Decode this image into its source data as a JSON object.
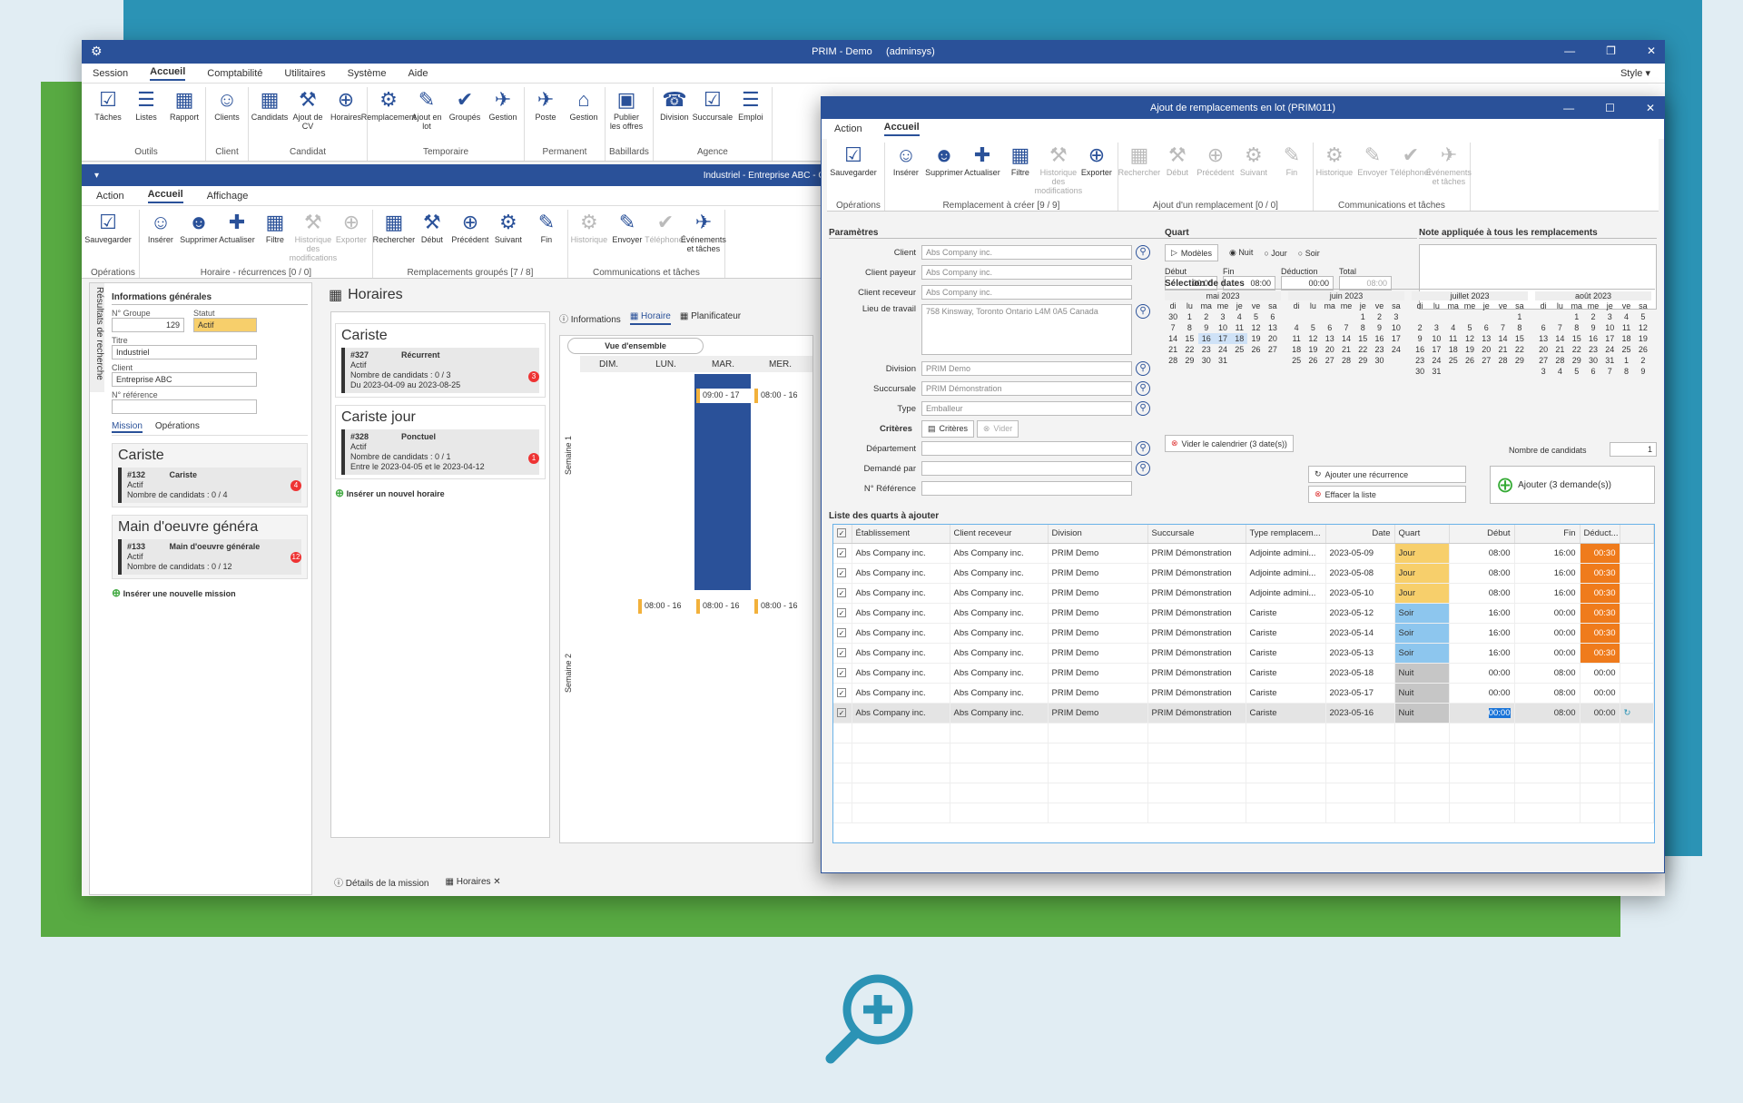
{
  "app": {
    "title": "PRIM - Demo",
    "user": "(adminsys)",
    "style_label": "Style"
  },
  "menu": [
    "Session",
    "Accueil",
    "Comptabilité",
    "Utilitaires",
    "Système",
    "Aide"
  ],
  "ribbon": {
    "groups": [
      {
        "label": "Outils",
        "buttons": [
          "Tâches",
          "Listes",
          "Rapport"
        ]
      },
      {
        "label": "Client",
        "buttons": [
          "Clients"
        ]
      },
      {
        "label": "Candidat",
        "buttons": [
          "Candidats",
          "Ajout de CV",
          "Horaires"
        ]
      },
      {
        "label": "Temporaire",
        "buttons": [
          "Remplacement",
          "Ajout en lot",
          "Groupés",
          "Gestion"
        ]
      },
      {
        "label": "Permanent",
        "buttons": [
          "Poste",
          "Gestion"
        ]
      },
      {
        "label": "Babillards",
        "buttons": [
          "Publier les offres"
        ]
      },
      {
        "label": "Agence",
        "buttons": [
          "Division",
          "Succursale",
          "Emploi"
        ]
      }
    ]
  },
  "sub": {
    "title": "Industriel - Entreprise ABC - Gestion des requêtes de temporaire multiple (PRIM005)",
    "tabs": [
      "Action",
      "Accueil",
      "Affichage"
    ],
    "groups": [
      {
        "label": "Opérations",
        "buttons": [
          "Sauvegarder"
        ]
      },
      {
        "label": "Horaire - récurrences [0 / 0]",
        "buttons": [
          "Insérer",
          "Supprimer",
          "Actualiser",
          "Filtre",
          "Historique des modifications",
          "Exporter"
        ]
      },
      {
        "label": "Remplacements groupés [7 / 8]",
        "buttons": [
          "Rechercher",
          "Début",
          "Précédent",
          "Suivant",
          "Fin"
        ]
      },
      {
        "label": "Communications et tâches",
        "buttons": [
          "Historique",
          "Envoyer",
          "Téléphoner",
          "Événements et tâches"
        ]
      }
    ]
  },
  "left": {
    "vtab": "Résultats de recherche",
    "section": "Informations générales",
    "groupe_label": "N° Groupe",
    "groupe": "129",
    "statut_label": "Statut",
    "statut": "Actif",
    "titre_label": "Titre",
    "titre": "Industriel",
    "client_label": "Client",
    "client": "Entreprise ABC",
    "ref_label": "N° référence",
    "tabs": [
      "Mission",
      "Opérations"
    ],
    "cards": [
      {
        "title": "Cariste",
        "id": "#132",
        "name": "Cariste",
        "status": "Actif",
        "cand": "Nombre de candidats : 0 / 4",
        "badge": "4"
      },
      {
        "title": "Main d'oeuvre généra",
        "id": "#133",
        "name": "Main d'oeuvre générale",
        "status": "Actif",
        "cand": "Nombre de candidats : 0 / 12",
        "badge": "12"
      }
    ],
    "add": "Insérer une nouvelle mission"
  },
  "center": {
    "title": "Horaires",
    "cards": [
      {
        "title": "Cariste",
        "id": "#327",
        "type": "Récurrent",
        "status": "Actif",
        "cand": "Nombre de candidats : 0 / 3",
        "dates": "Du 2023-04-09 au 2023-08-25",
        "badge": "3"
      },
      {
        "title": "Cariste jour",
        "id": "#328",
        "type": "Ponctuel",
        "status": "Actif",
        "cand": "Nombre de candidats : 0 / 1",
        "dates": "Entre le 2023-04-05 et le 2023-04-12",
        "badge": "1"
      }
    ],
    "add": "Insérer un nouvel horaire",
    "tabs": [
      "Informations",
      "Horaire",
      "Planificateur"
    ],
    "vue": "Vue d'ensemble",
    "days": [
      "DIM.",
      "LUN.",
      "MAR.",
      "MER."
    ],
    "chips": [
      "09:00 - 17",
      "08:00 - 16",
      "08:00 - 16",
      "08:00 - 16",
      "08:00 - 16"
    ],
    "semaines": [
      "Semaine 1",
      "Semaine 2"
    ],
    "bottom": [
      "Détails de la mission",
      "Horaires"
    ]
  },
  "dialog": {
    "title": "Ajout de remplacements en lot (PRIM011)",
    "tabs": [
      "Action",
      "Accueil"
    ],
    "groups": [
      {
        "label": "Opérations",
        "buttons": [
          "Sauvegarder"
        ]
      },
      {
        "label": "Remplacement à créer [9 / 9]",
        "buttons": [
          "Insérer",
          "Supprimer",
          "Actualiser",
          "Filtre",
          "Historique des modifications",
          "Exporter"
        ]
      },
      {
        "label": "Ajout d'un remplacement [0 / 0]",
        "buttons": [
          "Rechercher",
          "Début",
          "Précédent",
          "Suivant",
          "Fin"
        ]
      },
      {
        "label": "Communications et tâches",
        "buttons": [
          "Historique",
          "Envoyer",
          "Téléphoner",
          "Événements et tâches"
        ]
      }
    ],
    "params_title": "Paramètres",
    "params": [
      {
        "label": "Client",
        "value": "Abs Company inc."
      },
      {
        "label": "Client payeur",
        "value": "Abs Company inc."
      },
      {
        "label": "Client receveur",
        "value": "Abs Company inc."
      },
      {
        "label": "Lieu de travail",
        "value": "758 Kinsway, Toronto Ontario L4M 0A5 Canada"
      },
      {
        "label": "Division",
        "value": "PRIM Demo"
      },
      {
        "label": "Succursale",
        "value": "PRIM Démonstration"
      },
      {
        "label": "Type",
        "value": "Emballeur"
      }
    ],
    "criteres": "Critères",
    "criteres_btn": "Critères",
    "vider": "Vider",
    "params2": [
      {
        "label": "Département",
        "value": ""
      },
      {
        "label": "Demandé par",
        "value": ""
      },
      {
        "label": "N° Référence",
        "value": ""
      }
    ],
    "quart_title": "Quart",
    "modeles": "Modèles",
    "nuit": "Nuit",
    "jour": "Jour",
    "soir": "Soir",
    "debut_label": "Début",
    "fin_label": "Fin",
    "deduction_label": "Déduction",
    "total_label": "Total",
    "debut": "00:00",
    "fin": "08:00",
    "deduction": "00:00",
    "total": "08:00",
    "note_title": "Note appliquée à tous les remplacements",
    "sel_title": "Sélection de dates",
    "months": [
      {
        "name": "mai 2023",
        "days": [
          "30",
          "1",
          "2",
          "3",
          "4",
          "5",
          "6",
          "7",
          "8",
          "9",
          "10",
          "11",
          "12",
          "13",
          "14",
          "15",
          "16",
          "17",
          "18",
          "19",
          "20",
          "21",
          "22",
          "23",
          "24",
          "25",
          "26",
          "27",
          "28",
          "29",
          "30",
          "31"
        ]
      },
      {
        "name": "juin 2023",
        "days": [
          "",
          "",
          "",
          "",
          "1",
          "2",
          "3",
          "4",
          "5",
          "6",
          "7",
          "8",
          "9",
          "10",
          "11",
          "12",
          "13",
          "14",
          "15",
          "16",
          "17",
          "18",
          "19",
          "20",
          "21",
          "22",
          "23",
          "24",
          "25",
          "26",
          "27",
          "28",
          "29",
          "30"
        ]
      },
      {
        "name": "juillet 2023",
        "days": [
          "",
          "",
          "",
          "",
          "",
          "",
          "1",
          "2",
          "3",
          "4",
          "5",
          "6",
          "7",
          "8",
          "9",
          "10",
          "11",
          "12",
          "13",
          "14",
          "15",
          "16",
          "17",
          "18",
          "19",
          "20",
          "21",
          "22",
          "23",
          "24",
          "25",
          "26",
          "27",
          "28",
          "29",
          "30",
          "31"
        ]
      },
      {
        "name": "août 2023",
        "days": [
          "",
          "",
          "1",
          "2",
          "3",
          "4",
          "5",
          "6",
          "7",
          "8",
          "9",
          "10",
          "11",
          "12",
          "13",
          "14",
          "15",
          "16",
          "17",
          "18",
          "19",
          "20",
          "21",
          "22",
          "23",
          "24",
          "25",
          "26",
          "27",
          "28",
          "29",
          "30",
          "31",
          "1",
          "2",
          "3",
          "4",
          "5",
          "6",
          "7",
          "8",
          "9"
        ]
      }
    ],
    "dow": [
      "di",
      "lu",
      "ma",
      "me",
      "je",
      "ve",
      "sa"
    ],
    "vider_cal": "Vider le calendrier (3 date(s))",
    "nb_cand_label": "Nombre de candidats",
    "nb_cand": "1",
    "ajouter_rec": "Ajouter une récurrence",
    "effacer": "Effacer la liste",
    "ajouter": "Ajouter (3 demande(s))",
    "list_title": "Liste des quarts à ajouter",
    "cols": [
      "Établissement",
      "Client receveur",
      "Division",
      "Succursale",
      "Type remplacem...",
      "Date",
      "Quart",
      "Début",
      "Fin",
      "Déduct..."
    ],
    "rows": [
      [
        "Abs Company inc.",
        "Abs Company inc.",
        "PRIM Demo",
        "PRIM Démonstration",
        "Adjointe admini...",
        "2023-05-09",
        "Jour",
        "08:00",
        "16:00",
        "00:30"
      ],
      [
        "Abs Company inc.",
        "Abs Company inc.",
        "PRIM Demo",
        "PRIM Démonstration",
        "Adjointe admini...",
        "2023-05-08",
        "Jour",
        "08:00",
        "16:00",
        "00:30"
      ],
      [
        "Abs Company inc.",
        "Abs Company inc.",
        "PRIM Demo",
        "PRIM Démonstration",
        "Adjointe admini...",
        "2023-05-10",
        "Jour",
        "08:00",
        "16:00",
        "00:30"
      ],
      [
        "Abs Company inc.",
        "Abs Company inc.",
        "PRIM Demo",
        "PRIM Démonstration",
        "Cariste",
        "2023-05-12",
        "Soir",
        "16:00",
        "00:00",
        "00:30"
      ],
      [
        "Abs Company inc.",
        "Abs Company inc.",
        "PRIM Demo",
        "PRIM Démonstration",
        "Cariste",
        "2023-05-14",
        "Soir",
        "16:00",
        "00:00",
        "00:30"
      ],
      [
        "Abs Company inc.",
        "Abs Company inc.",
        "PRIM Demo",
        "PRIM Démonstration",
        "Cariste",
        "2023-05-13",
        "Soir",
        "16:00",
        "00:00",
        "00:30"
      ],
      [
        "Abs Company inc.",
        "Abs Company inc.",
        "PRIM Demo",
        "PRIM Démonstration",
        "Cariste",
        "2023-05-18",
        "Nuit",
        "00:00",
        "08:00",
        "00:00"
      ],
      [
        "Abs Company inc.",
        "Abs Company inc.",
        "PRIM Demo",
        "PRIM Démonstration",
        "Cariste",
        "2023-05-17",
        "Nuit",
        "00:00",
        "08:00",
        "00:00"
      ],
      [
        "Abs Company inc.",
        "Abs Company inc.",
        "PRIM Demo",
        "PRIM Démonstration",
        "Cariste",
        "2023-05-16",
        "Nuit",
        "00:00",
        "08:00",
        "00:00"
      ]
    ]
  },
  "colors": {
    "accent": "#2a5199",
    "jour": "#f7cf6b",
    "soir": "#8dc6ee",
    "nuit": "#c6c6c6",
    "deduction": "#ef7b1c"
  }
}
